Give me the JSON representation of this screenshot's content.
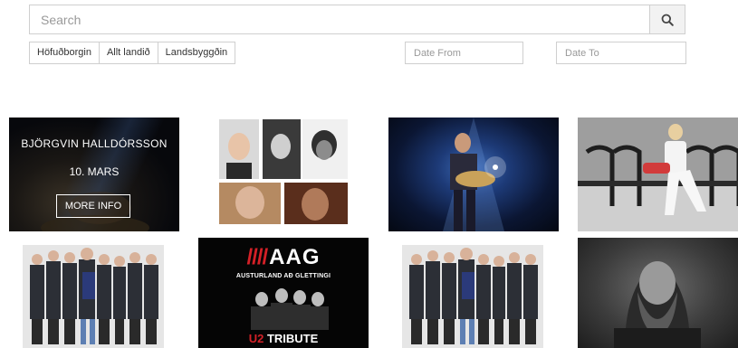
{
  "search": {
    "placeholder": "Search",
    "icon": "search-icon"
  },
  "regions": [
    "Höfuðborgin",
    "Allt landið",
    "Landsbyggðin"
  ],
  "dates": {
    "from_placeholder": "Date From",
    "to_placeholder": "Date To"
  },
  "events": {
    "featured": {
      "name": "BJÖRGVIN HALLDÓRSSON",
      "date": "10. MARS",
      "cta": "MORE INFO"
    },
    "aag": {
      "bars": "////",
      "title": "AAG",
      "subtitle": "AUSTURLAND AÐ GLETTINGI",
      "tribute_u2": "U2",
      "tribute_word": "TRIBUTE"
    }
  }
}
